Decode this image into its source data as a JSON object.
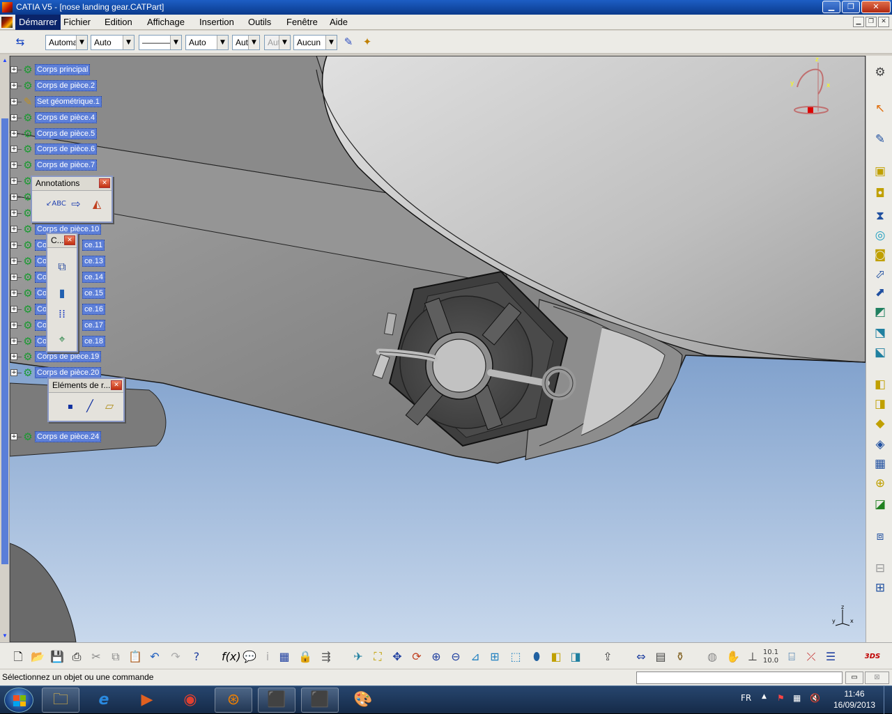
{
  "window": {
    "title": "CATIA V5 - [nose landing gear.CATPart]"
  },
  "menus": [
    "Démarrer",
    "Fichier",
    "Edition",
    "Affichage",
    "Insertion",
    "Outils",
    "Fenêtre",
    "Aide"
  ],
  "toolbar": {
    "combo1": "Automa",
    "combo2": "Auto",
    "combo3": "————",
    "combo4": "Auto",
    "combo5": "Aut",
    "combo6": "Aut",
    "combo7": "Aucun"
  },
  "tree": {
    "items": [
      "Corps principal",
      "Corps de pièce.2",
      "Set géométrique.1",
      "Corps de pièce.4",
      "Corps de pièce.5",
      "Corps de pièce.6",
      "Corps de pièce.7",
      "Corps de pièce.10",
      "ce.11",
      "ce.13",
      "ce.14",
      "ce.15",
      "ce.16",
      "ce.17",
      "ce.18",
      "Corps de pièce.19",
      "Corps de pièce.20",
      "Corps de pièce.24"
    ],
    "partial": [
      "Co",
      "Co",
      "Co",
      "Co",
      "Co",
      "Co",
      "Co",
      "Co",
      "Co",
      "Co"
    ]
  },
  "palettes": {
    "annotations": "Annotations",
    "constraints": "C...",
    "reference": "Eléments de r..."
  },
  "status": {
    "prompt": "Sélectionnez un objet ou une commande"
  },
  "taskbar": {
    "lang": "FR",
    "time": "11:46",
    "date": "16/09/2013"
  },
  "colors": {
    "title_blue": "#0a3a8c",
    "selection_blue": "#5d7fd8",
    "sky_top": "#3f6fb3",
    "sky_bottom": "#c8d8ec",
    "part_gray": "#8a8a8a"
  }
}
